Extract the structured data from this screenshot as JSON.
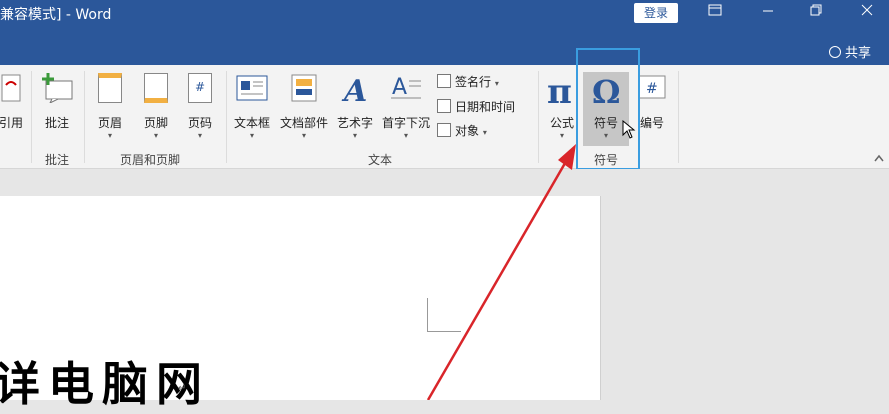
{
  "titlebar": {
    "title": "兼容模式] - Word",
    "login": "登录",
    "share": "共享",
    "colors": {
      "bar": "#2b579a",
      "text": "#ffffff"
    }
  },
  "ribbon": {
    "groups": [
      {
        "label": "批注"
      },
      {
        "label": "页眉和页脚"
      },
      {
        "label": "文本"
      },
      {
        "label": "符号"
      }
    ],
    "buttons": {
      "yinyong": "引用",
      "pizhu": "批注",
      "yemei": "页眉",
      "yejiao": "页脚",
      "yema": "页码",
      "wenbenkuang": "文本框",
      "wendangbujian": "文档部件",
      "yishuzi": "艺术字",
      "shouzixiachen": "首字下沉",
      "qianmingxing": "签名行",
      "riqiheshijian": "日期和时间",
      "duixiang": "对象",
      "gongshi": "公式",
      "fuhao": "符号",
      "bianhao": "编号"
    },
    "dropdown_arrow": "▾",
    "collapse_icon": "chevron-up-icon"
  },
  "document": {
    "text": "详电脑网",
    "paragraph_mark": "↵"
  },
  "annotation": {
    "box_color": "#3a9de0",
    "arrow_color": "#d9252a"
  }
}
